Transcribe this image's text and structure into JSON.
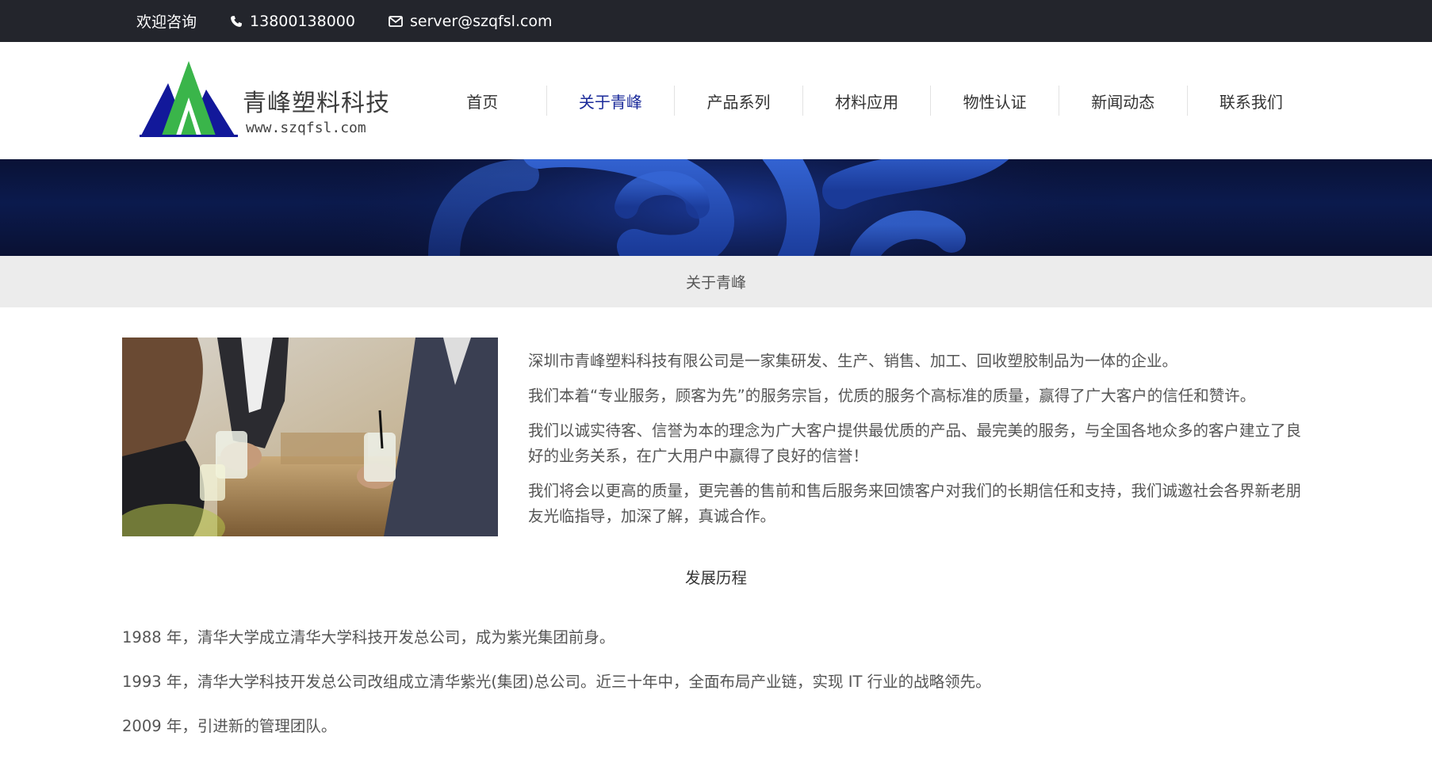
{
  "topbar": {
    "welcome": "欢迎咨询",
    "phone": "13800138000",
    "email": "server@szqfsl.com",
    "phone_icon": "phone-icon",
    "email_icon": "envelope-icon"
  },
  "header": {
    "logo_name": "青峰塑料科技",
    "logo_site": "www.szqfsl.com",
    "nav": [
      {
        "label": "首页",
        "active": false
      },
      {
        "label": "关于青峰",
        "active": true
      },
      {
        "label": "产品系列",
        "active": false
      },
      {
        "label": "材料应用",
        "active": false
      },
      {
        "label": "物性认证",
        "active": false
      },
      {
        "label": "新闻动态",
        "active": false
      },
      {
        "label": "联系我们",
        "active": false
      }
    ]
  },
  "section": {
    "title": "关于青峰"
  },
  "intro": {
    "paragraphs": [
      "深圳市青峰塑料科技有限公司是一家集研发、生产、销售、加工、回收塑胶制品为一体的企业。",
      "我们本着“专业服务，顾客为先”的服务宗旨，优质的服务个高标准的质量，赢得了广大客户的信任和赞许。",
      "我们以诚实待客、信誉为本的理念为广大客户提供最优质的产品、最完美的服务，与全国各地众多的客户建立了良好的业务关系，在广大用户中赢得了良好的信誉！",
      "我们将会以更高的质量，更完善的售前和售后服务来回馈客户对我们的长期信任和支持，我们诚邀社会各界新老朋友光临指导，加深了解，真诚合作。"
    ]
  },
  "history": {
    "title": "发展历程",
    "items": [
      "1988 年，清华大学成立清华大学科技开发总公司，成为紫光集团前身。",
      "1993 年，清华大学科技开发总公司改组成立清华紫光(集团)总公司。近三十年中，全面布局产业链，实现 IT 行业的战略领先。",
      "2009 年，引进新的管理团队。"
    ]
  },
  "colors": {
    "topbar_bg": "#23252c",
    "nav_active": "#1a2a9a",
    "titlebar_bg": "#ececec",
    "logo_blue": "#12189a",
    "logo_green": "#3ab54a"
  }
}
